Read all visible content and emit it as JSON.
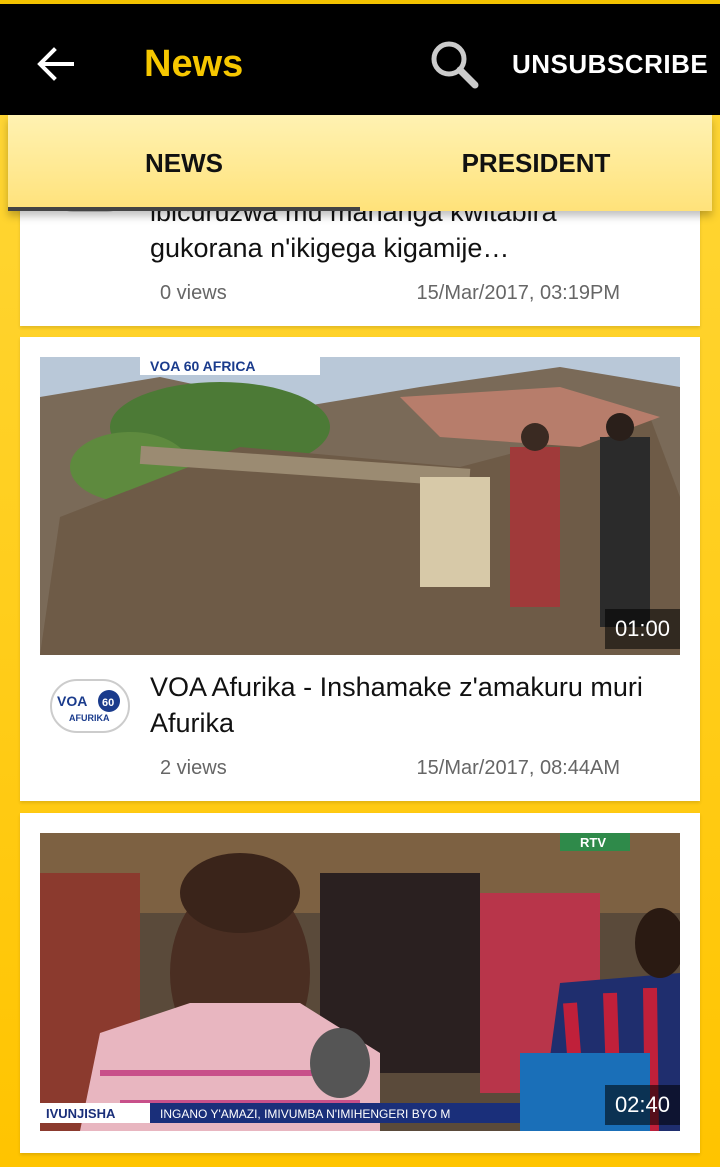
{
  "appbar": {
    "title": "News",
    "unsubscribe_label": "UNSUBSCRIBE"
  },
  "tabs": [
    {
      "label": "NEWS",
      "selected": true
    },
    {
      "label": "PRESIDENT",
      "selected": false
    }
  ],
  "videos": [
    {
      "title": "ibicuruzwa mu mahanga kwitabira gukorana n'ikigega kigamije…",
      "views": "0 views",
      "date": "15/Mar/2017, 03:19PM"
    },
    {
      "title": "VOA Afurika - Inshamake z'amakuru muri Afurika",
      "views": "2 views",
      "date": "15/Mar/2017, 08:44AM",
      "duration": "01:00",
      "channel_logo_text": "VOA 60 AFURIKA",
      "thumb_overlay": "VOA 60 AFRICA"
    },
    {
      "duration": "02:40",
      "thumb_overlay": "RTV",
      "ticker_left": "IVUNJISHA",
      "ticker_text": "INGANO Y'AMAZI, IMIVUMBA N'IMIHENGERI BYO M"
    }
  ],
  "colors": {
    "accent": "#f6c700",
    "appbar_bg": "#000000",
    "background": "#ffcc00"
  },
  "icons": [
    "back-arrow-icon",
    "search-icon"
  ]
}
